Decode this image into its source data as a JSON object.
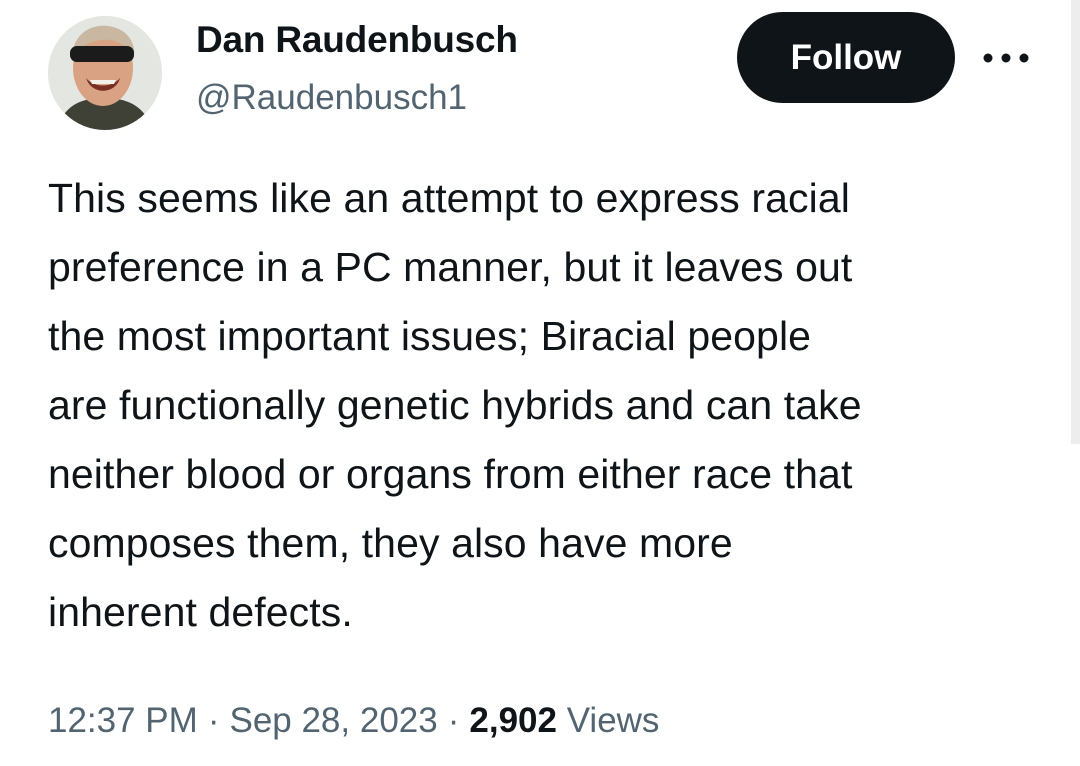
{
  "author": {
    "display_name": "Dan Raudenbusch",
    "handle": "@Raudenbusch1"
  },
  "actions": {
    "follow_label": "Follow",
    "more_icon": "more-horizontal-icon"
  },
  "tweet": {
    "text": "This seems like an attempt to express racial\npreference in a PC manner, but it leaves out\nthe most important issues; Biracial people\nare functionally genetic hybrids and can take\nneither blood or organs from either race that\ncomposes them, they also have more\ninherent defects.",
    "time": "12:37 PM",
    "date": "Sep 28, 2023",
    "views_count": "2,902",
    "views_label": "Views",
    "separator": "·"
  },
  "colors": {
    "text_primary": "#0f1419",
    "text_secondary": "#536471",
    "button_bg": "#0f1419",
    "button_text": "#ffffff"
  }
}
